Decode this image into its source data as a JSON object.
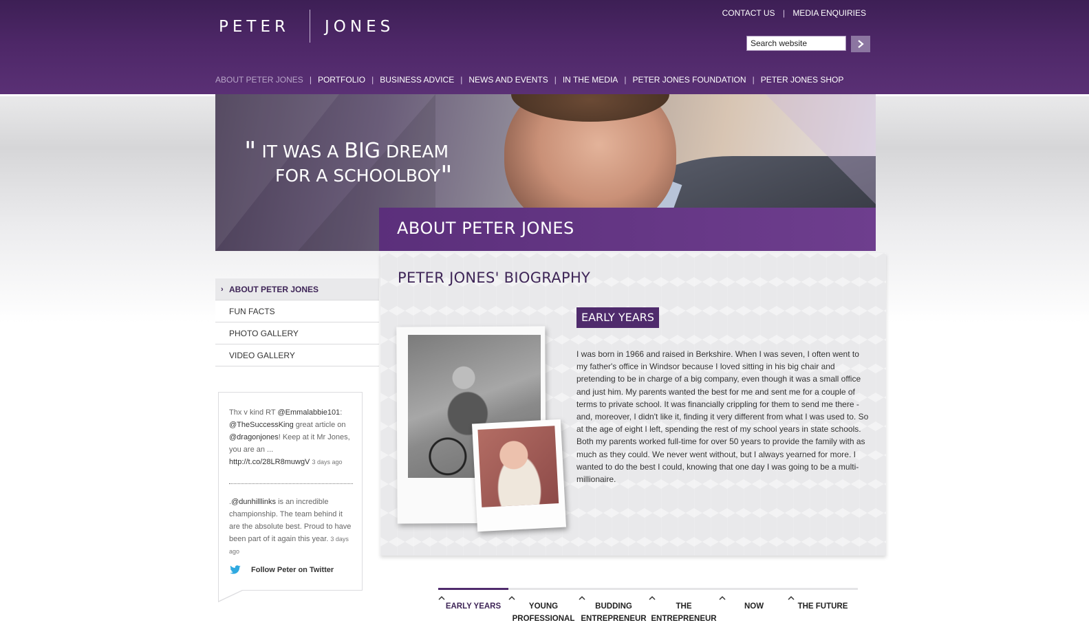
{
  "header": {
    "logo": {
      "first": "PETER",
      "last": "JONES"
    },
    "top_links": [
      "CONTACT US",
      "MEDIA ENQUIRIES"
    ],
    "search": {
      "placeholder": "Search website"
    },
    "nav": [
      {
        "label": "ABOUT PETER JONES",
        "active": true
      },
      {
        "label": "PORTFOLIO"
      },
      {
        "label": "BUSINESS ADVICE"
      },
      {
        "label": "NEWS AND EVENTS"
      },
      {
        "label": "IN THE MEDIA"
      },
      {
        "label": "PETER JONES FOUNDATION"
      },
      {
        "label": "PETER JONES SHOP"
      }
    ]
  },
  "hero": {
    "quote_open": "\"",
    "quote_line1_a": "IT WAS A ",
    "quote_line1_b": "BIG",
    "quote_line1_c": " DREAM",
    "quote_line2": "FOR A SCHOOLBOY",
    "quote_close": "\"",
    "banner_title": "ABOUT PETER JONES"
  },
  "sidebar": {
    "items": [
      {
        "label": "ABOUT PETER JONES",
        "active": true
      },
      {
        "label": "FUN FACTS"
      },
      {
        "label": "PHOTO GALLERY"
      },
      {
        "label": "VIDEO GALLERY"
      }
    ],
    "twitter": {
      "tweet1": {
        "t1": "Thx v kind RT ",
        "m1": "@Emmalabbie101",
        "t2": ": ",
        "m2": "@TheSuccessKing",
        "t3": " great article on ",
        "m3": "@dragonjones",
        "t4": "! Keep at it Mr Jones, you are an ... ",
        "link": "http://t.co/28LR8muwgV",
        "time": "3 days ago"
      },
      "tweet2": {
        "t1": ".",
        "m1": "@dunhilllinks",
        "t2": " is an incredible championship. The team behind it are the absolute best. Proud to have been part of it again this year.",
        "time": "3 days ago"
      },
      "follow": "Follow Peter on Twitter"
    }
  },
  "main": {
    "page_title": "PETER JONES' BIOGRAPHY",
    "section_title": "EARLY YEARS",
    "bio": "I was born in 1966 and raised in Berkshire. When I was seven, I often went to my father's office in Windsor because I loved sitting in his big chair and pretending to be in charge of a big company, even though it was a small office and just him. My parents wanted the best for me and sent me for a couple of terms to private school. It was financially crippling for them to send me there - and, moreover, I didn't like it, finding it very different from what I was used to. So at the age of eight I left, spending the rest of my school years in state schools. Both my parents worked full-time for over 50 years to provide the family with as much as they could. We never went without, but I always yearned for more. I wanted to do the best I could, knowing that one day I was going to be a multi-millionaire."
  },
  "timeline": {
    "tabs": [
      {
        "l1": "EARLY YEARS",
        "l2": "",
        "active": true
      },
      {
        "l1": "YOUNG",
        "l2": "PROFESSIONAL"
      },
      {
        "l1": "BUDDING",
        "l2": "ENTREPRENEUR"
      },
      {
        "l1": "THE",
        "l2": "ENTREPRENEUR"
      },
      {
        "l1": "NOW",
        "l2": ""
      },
      {
        "l1": "THE FUTURE",
        "l2": ""
      }
    ]
  },
  "colors": {
    "brand_purple": "#4f2b6c",
    "header_purple": "#4d2767",
    "banner_purple": "#6e3e8e",
    "twitter_blue": "#2fa9e0"
  }
}
